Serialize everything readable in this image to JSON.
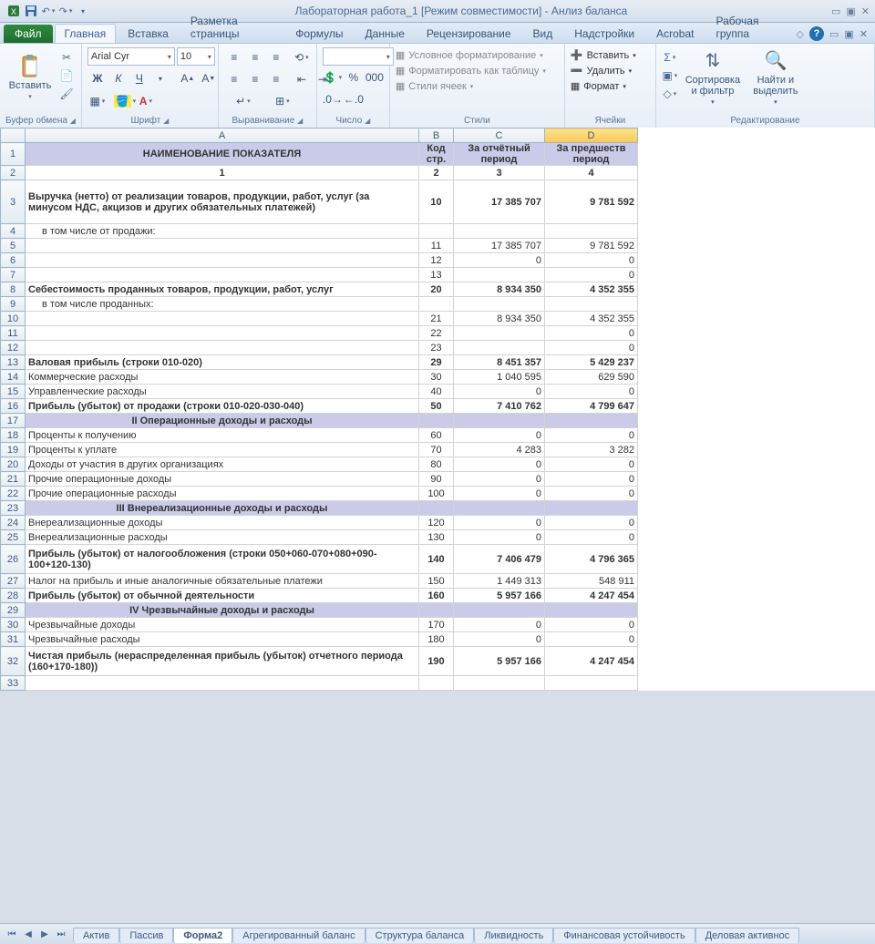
{
  "window": {
    "title": "Лабораторная работа_1  [Режим совместимости]  -  Анлиз баланса"
  },
  "tabs": {
    "file": "Файл",
    "items": [
      "Главная",
      "Вставка",
      "Разметка страницы",
      "Формулы",
      "Данные",
      "Рецензирование",
      "Вид",
      "Надстройки",
      "Acrobat",
      "Рабочая группа"
    ],
    "active": 0
  },
  "ribbon": {
    "clipboard": {
      "label": "Буфер обмена",
      "paste": "Вставить"
    },
    "font": {
      "label": "Шрифт",
      "name": "Arial Cyr",
      "size": "10"
    },
    "align": {
      "label": "Выравнивание"
    },
    "number": {
      "label": "Число"
    },
    "styles": {
      "label": "Стили",
      "cond": "Условное форматирование",
      "table": "Форматировать как таблицу",
      "cell": "Стили ячеек"
    },
    "cells": {
      "label": "Ячейки",
      "insert": "Вставить",
      "delete": "Удалить",
      "format": "Формат"
    },
    "edit": {
      "label": "Редактирование",
      "sort": "Сортировка и фильтр",
      "find": "Найти и выделить"
    }
  },
  "columns": {
    "A": "A",
    "B": "B",
    "C": "C",
    "D": "D"
  },
  "headers": {
    "A": "НАИМЕНОВАНИЕ ПОКАЗАТЕЛЯ",
    "B": "Код стр.",
    "C": "За отчётный период",
    "D": "За предшеств период",
    "r2A": "1",
    "r2B": "2",
    "r2C": "3",
    "r2D": "4"
  },
  "rows": [
    {
      "n": 3,
      "tall": "tall",
      "bold": true,
      "A": "Выручка (нетто) от реализации товаров, продукции, работ, услуг (за минусом НДС, акцизов и других обязательных платежей)",
      "B": "10",
      "C": "17 385 707",
      "D": "9 781 592"
    },
    {
      "n": 4,
      "indent": true,
      "A": "в том числе от продажи:",
      "B": "",
      "C": "",
      "D": ""
    },
    {
      "n": 5,
      "A": "",
      "B": "11",
      "C": "17 385 707",
      "D": "9 781 592"
    },
    {
      "n": 6,
      "A": "",
      "B": "12",
      "C": "0",
      "D": "0"
    },
    {
      "n": 7,
      "A": "",
      "B": "13",
      "C": "",
      "D": "0"
    },
    {
      "n": 8,
      "bold": true,
      "A": "Себестоимость проданных товаров, продукции, работ, услуг",
      "B": "20",
      "C": "8 934 350",
      "D": "4 352 355"
    },
    {
      "n": 9,
      "indent": true,
      "A": "в том числе проданных:",
      "B": "",
      "C": "",
      "D": ""
    },
    {
      "n": 10,
      "A": "",
      "B": "21",
      "C": "8 934 350",
      "D": "4 352 355"
    },
    {
      "n": 11,
      "A": "",
      "B": "22",
      "C": "",
      "D": "0"
    },
    {
      "n": 12,
      "A": "",
      "B": "23",
      "C": "",
      "D": "0"
    },
    {
      "n": 13,
      "bold": true,
      "A": "Валовая прибыль (строки 010-020)",
      "B": "29",
      "C": "8 451 357",
      "D": "5 429 237"
    },
    {
      "n": 14,
      "A": "Коммерческие расходы",
      "B": "30",
      "C": "1 040 595",
      "D": "629 590"
    },
    {
      "n": 15,
      "A": "Управленческие расходы",
      "B": "40",
      "C": "0",
      "D": "0"
    },
    {
      "n": 16,
      "bold": true,
      "A": "Прибыль (убыток) от продажи (строки 010-020-030-040)",
      "B": "50",
      "C": "7 410 762",
      "D": "4 799 647"
    },
    {
      "n": 17,
      "section": true,
      "A": "II Операционные доходы и расходы",
      "B": "",
      "C": "",
      "D": ""
    },
    {
      "n": 18,
      "A": "Проценты к получению",
      "B": "60",
      "C": "0",
      "D": "0"
    },
    {
      "n": 19,
      "A": "Проценты к уплате",
      "B": "70",
      "C": "4 283",
      "D": "3 282"
    },
    {
      "n": 20,
      "A": "Доходы от участия в других организациях",
      "B": "80",
      "C": "0",
      "D": "0"
    },
    {
      "n": 21,
      "A": "Прочие операционные доходы",
      "B": "90",
      "C": "0",
      "D": "0"
    },
    {
      "n": 22,
      "A": "Прочие операционные расходы",
      "B": "100",
      "C": "0",
      "D": "0"
    },
    {
      "n": 23,
      "section": true,
      "A": "III Внереализационные доходы и расходы",
      "B": "",
      "C": "",
      "D": ""
    },
    {
      "n": 24,
      "A": "Внереализационные доходы",
      "B": "120",
      "C": "0",
      "D": "0"
    },
    {
      "n": 25,
      "A": "Внереализационные расходы",
      "B": "130",
      "C": "0",
      "D": "0"
    },
    {
      "n": 26,
      "tall": "tall2",
      "bold": true,
      "A": "Прибыль (убыток) от налогообложения (строки 050+060-070+080+090-100+120-130)",
      "B": "140",
      "C": "7 406 479",
      "D": "4 796 365"
    },
    {
      "n": 27,
      "A": "Налог на прибыль и иные аналогичные обязательные платежи",
      "B": "150",
      "C": "1 449 313",
      "D": "548 911"
    },
    {
      "n": 28,
      "bold": true,
      "A": "Прибыль (убыток) от обычной деятельности",
      "B": "160",
      "C": "5 957 166",
      "D": "4 247 454"
    },
    {
      "n": 29,
      "section": true,
      "A": "IV Чрезвычайные доходы и расходы",
      "B": "",
      "C": "",
      "D": ""
    },
    {
      "n": 30,
      "A": "Чрезвычайные доходы",
      "B": "170",
      "C": "0",
      "D": "0"
    },
    {
      "n": 31,
      "A": "Чрезвычайные расходы",
      "B": "180",
      "C": "0",
      "D": "0"
    },
    {
      "n": 32,
      "tall": "tall2",
      "bold": true,
      "A": "Чистая прибыль (нераспределенная прибыль (убыток) отчетного периода (160+170-180))",
      "B": "190",
      "C": "5 957 166",
      "D": "4 247 454"
    },
    {
      "n": 33,
      "A": "",
      "B": "",
      "C": "",
      "D": ""
    }
  ],
  "sheets": {
    "items": [
      "Актив",
      "Пассив",
      "Форма2",
      "Агрегированный баланс",
      "Структура баланса",
      "Ликвидность",
      "Финансовая устойчивость",
      "Деловая активнос"
    ],
    "active": 2
  }
}
